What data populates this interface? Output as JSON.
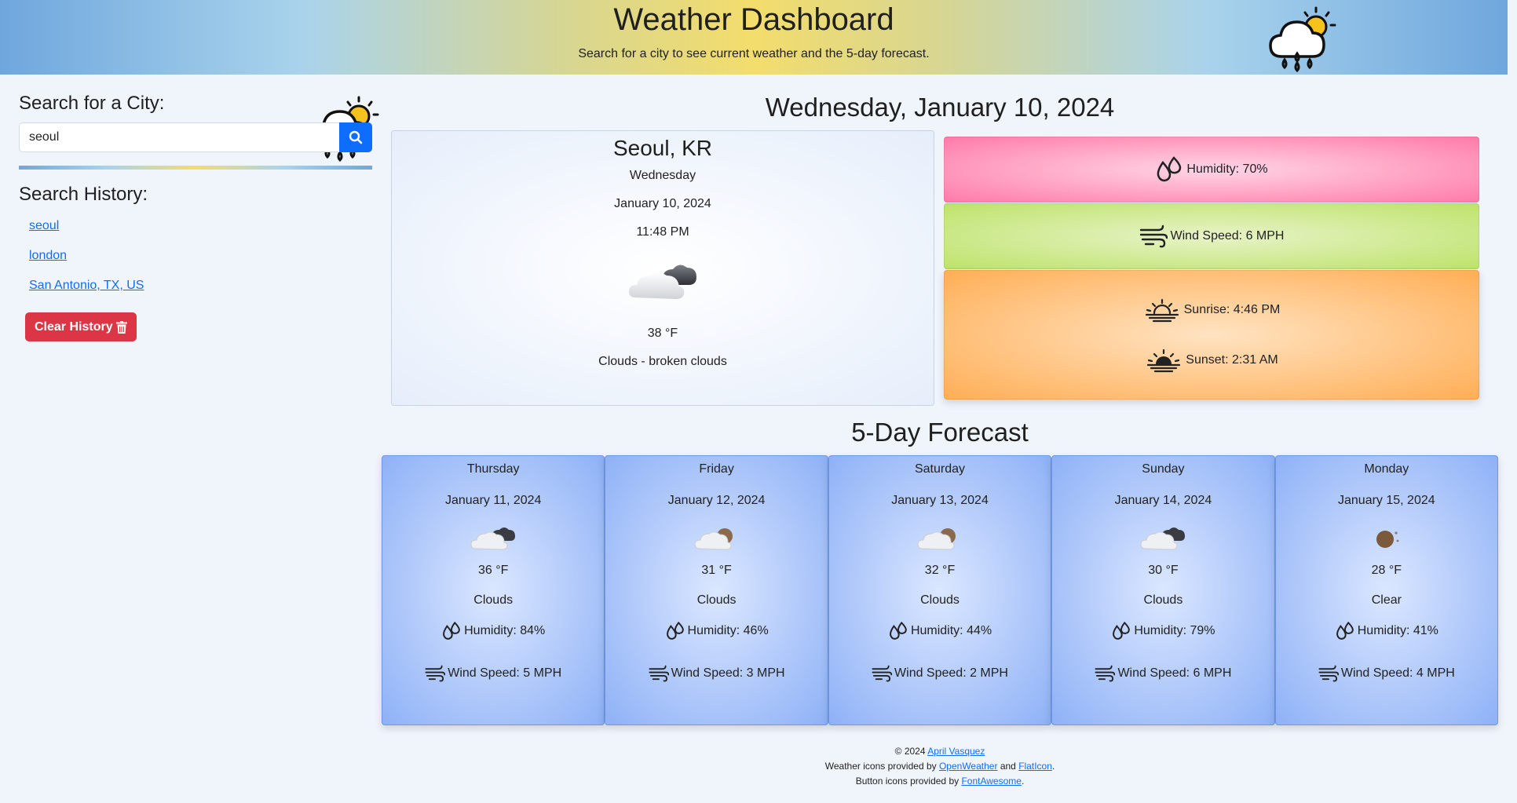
{
  "header": {
    "title": "Weather Dashboard",
    "subtitle": "Search for a city to see current weather and the 5-day forecast.",
    "left_icon": "rain-sun-cloud-icon",
    "right_icon": "rain-sun-cloud-icon"
  },
  "search": {
    "heading": "Search for a City:",
    "value": "seoul",
    "button_icon": "search-icon"
  },
  "history": {
    "heading": "Search History:",
    "items": [
      "seoul",
      "london",
      "San Antonio, TX, US"
    ],
    "clear_label": "Clear History",
    "clear_icon": "trash-icon"
  },
  "current": {
    "date_heading": "Wednesday, January 10, 2024",
    "city": "Seoul, KR",
    "weekday": "Wednesday",
    "date": "January 10, 2024",
    "time": "11:48 PM",
    "icon": "broken-clouds-icon",
    "temp": "38 °F",
    "description": "Clouds - broken clouds",
    "humidity": "Humidity: 70%",
    "wind": "Wind Speed: 6 MPH",
    "sunrise": "Sunrise: 4:46 PM",
    "sunset": "Sunset: 2:31 AM"
  },
  "forecast": {
    "heading": "5-Day Forecast",
    "days": [
      {
        "day": "Thursday",
        "date": "January 11, 2024",
        "icon": "broken-clouds-icon",
        "temp": "36 °F",
        "desc": "Clouds",
        "humidity": "Humidity: 84%",
        "wind": "Wind Speed: 5 MPH"
      },
      {
        "day": "Friday",
        "date": "January 12, 2024",
        "icon": "few-clouds-night-icon",
        "temp": "31 °F",
        "desc": "Clouds",
        "humidity": "Humidity: 46%",
        "wind": "Wind Speed: 3 MPH"
      },
      {
        "day": "Saturday",
        "date": "January 13, 2024",
        "icon": "few-clouds-night-icon",
        "temp": "32 °F",
        "desc": "Clouds",
        "humidity": "Humidity: 44%",
        "wind": "Wind Speed: 2 MPH"
      },
      {
        "day": "Sunday",
        "date": "January 14, 2024",
        "icon": "broken-clouds-icon",
        "temp": "30 °F",
        "desc": "Clouds",
        "humidity": "Humidity: 79%",
        "wind": "Wind Speed: 6 MPH"
      },
      {
        "day": "Monday",
        "date": "January 15, 2024",
        "icon": "clear-night-icon",
        "temp": "28 °F",
        "desc": "Clear",
        "humidity": "Humidity: 41%",
        "wind": "Wind Speed: 4 MPH"
      }
    ]
  },
  "footer": {
    "copyright": "© 2024",
    "author": "April Vasquez",
    "weather_prefix": "Weather icons provided by",
    "openweather": "OpenWeather",
    "and": "and",
    "flaticon": "FlatIcon",
    "period": ".",
    "button_prefix": "Button icons provided by",
    "fontawesome": "FontAwesome"
  }
}
